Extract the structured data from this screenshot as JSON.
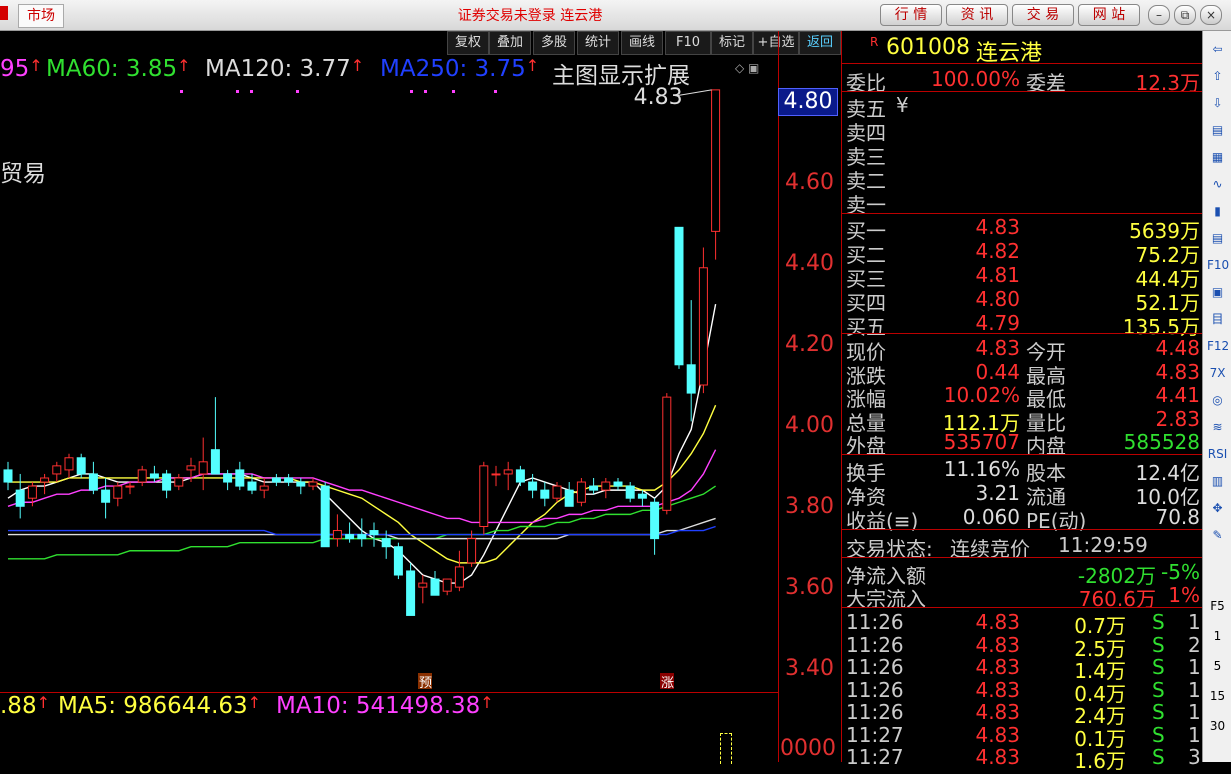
{
  "titlebar": {
    "market_label": "市场",
    "title": "证券交易未登录 连云港",
    "buttons": [
      "行 情",
      "资 讯",
      "交 易",
      "网 站"
    ],
    "win_controls": [
      "–",
      "⧉",
      "×"
    ]
  },
  "toolbar": {
    "items": [
      "复权",
      "叠加",
      "多股",
      "统计",
      "画线",
      "F10",
      "标记",
      "+自选",
      "返回"
    ],
    "active": "返回"
  },
  "ma_row": [
    {
      "label": "95",
      "arrow": "↑",
      "color": "#ff40ff"
    },
    {
      "label": "MA60: 3.85",
      "arrow": "↑",
      "color": "#30e030"
    },
    {
      "label": "MA120: 3.77",
      "arrow": "↑",
      "color": "#dddddd"
    },
    {
      "label": "MA250: 3.75",
      "arrow": "↑",
      "color": "#2040ff"
    }
  ],
  "chart_title_ext": "主图显示扩展",
  "sector_text": "贸易",
  "peak_label": "4.83",
  "markers": {
    "yu": "预",
    "zhang": "涨"
  },
  "price_tag": "4.80",
  "vol_row": [
    {
      "label": ".88",
      "arrow": "↑",
      "color": "#ffff40"
    },
    {
      "label": "MA5: 986644.63",
      "arrow": "↑",
      "color": "#ffff40"
    },
    {
      "label": "MA10: 541498.38",
      "arrow": "↑",
      "color": "#ff40ff"
    }
  ],
  "vol_axis_label": "0000",
  "chart_data": {
    "type": "candlestick",
    "y_ticks": [
      "4.60",
      "4.40",
      "4.20",
      "4.00",
      "3.80",
      "3.60",
      "3.40"
    ],
    "ylim": [
      3.37,
      4.88
    ],
    "candles": [
      {
        "o": 3.89,
        "h": 3.91,
        "l": 3.84,
        "c": 3.86
      },
      {
        "o": 3.84,
        "h": 3.88,
        "l": 3.77,
        "c": 3.8
      },
      {
        "o": 3.82,
        "h": 3.86,
        "l": 3.8,
        "c": 3.85
      },
      {
        "o": 3.86,
        "h": 3.88,
        "l": 3.83,
        "c": 3.87
      },
      {
        "o": 3.88,
        "h": 3.91,
        "l": 3.86,
        "c": 3.9
      },
      {
        "o": 3.89,
        "h": 3.93,
        "l": 3.87,
        "c": 3.92
      },
      {
        "o": 3.92,
        "h": 3.93,
        "l": 3.87,
        "c": 3.88
      },
      {
        "o": 3.88,
        "h": 3.91,
        "l": 3.83,
        "c": 3.84
      },
      {
        "o": 3.84,
        "h": 3.87,
        "l": 3.77,
        "c": 3.81
      },
      {
        "o": 3.82,
        "h": 3.86,
        "l": 3.8,
        "c": 3.85
      },
      {
        "o": 3.85,
        "h": 3.86,
        "l": 3.83,
        "c": 3.85
      },
      {
        "o": 3.86,
        "h": 3.9,
        "l": 3.85,
        "c": 3.89
      },
      {
        "o": 3.88,
        "h": 3.9,
        "l": 3.86,
        "c": 3.87
      },
      {
        "o": 3.88,
        "h": 3.89,
        "l": 3.82,
        "c": 3.84
      },
      {
        "o": 3.85,
        "h": 3.88,
        "l": 3.84,
        "c": 3.87
      },
      {
        "o": 3.89,
        "h": 3.92,
        "l": 3.86,
        "c": 3.9
      },
      {
        "o": 3.88,
        "h": 3.97,
        "l": 3.84,
        "c": 3.91
      },
      {
        "o": 3.94,
        "h": 4.07,
        "l": 3.9,
        "c": 3.88
      },
      {
        "o": 3.88,
        "h": 3.89,
        "l": 3.84,
        "c": 3.86
      },
      {
        "o": 3.89,
        "h": 3.91,
        "l": 3.84,
        "c": 3.85
      },
      {
        "o": 3.86,
        "h": 3.88,
        "l": 3.83,
        "c": 3.84
      },
      {
        "o": 3.84,
        "h": 3.87,
        "l": 3.82,
        "c": 3.85
      },
      {
        "o": 3.87,
        "h": 3.88,
        "l": 3.85,
        "c": 3.86
      },
      {
        "o": 3.87,
        "h": 3.88,
        "l": 3.85,
        "c": 3.86
      },
      {
        "o": 3.86,
        "h": 3.87,
        "l": 3.83,
        "c": 3.85
      },
      {
        "o": 3.85,
        "h": 3.87,
        "l": 3.84,
        "c": 3.86
      },
      {
        "o": 3.85,
        "h": 3.86,
        "l": 3.72,
        "c": 3.7
      },
      {
        "o": 3.72,
        "h": 3.78,
        "l": 3.7,
        "c": 3.74
      },
      {
        "o": 3.73,
        "h": 3.76,
        "l": 3.71,
        "c": 3.72
      },
      {
        "o": 3.73,
        "h": 3.77,
        "l": 3.7,
        "c": 3.72
      },
      {
        "o": 3.74,
        "h": 3.76,
        "l": 3.7,
        "c": 3.73
      },
      {
        "o": 3.72,
        "h": 3.74,
        "l": 3.67,
        "c": 3.7
      },
      {
        "o": 3.7,
        "h": 3.71,
        "l": 3.62,
        "c": 3.63
      },
      {
        "o": 3.64,
        "h": 3.66,
        "l": 3.55,
        "c": 3.53
      },
      {
        "o": 3.6,
        "h": 3.63,
        "l": 3.56,
        "c": 3.61
      },
      {
        "o": 3.62,
        "h": 3.64,
        "l": 3.58,
        "c": 3.58
      },
      {
        "o": 3.59,
        "h": 3.62,
        "l": 3.58,
        "c": 3.62
      },
      {
        "o": 3.6,
        "h": 3.69,
        "l": 3.59,
        "c": 3.65
      },
      {
        "o": 3.66,
        "h": 3.74,
        "l": 3.65,
        "c": 3.72
      },
      {
        "o": 3.75,
        "h": 3.91,
        "l": 3.73,
        "c": 3.9
      },
      {
        "o": 3.88,
        "h": 3.9,
        "l": 3.85,
        "c": 3.88
      },
      {
        "o": 3.88,
        "h": 3.91,
        "l": 3.84,
        "c": 3.89
      },
      {
        "o": 3.89,
        "h": 3.9,
        "l": 3.85,
        "c": 3.86
      },
      {
        "o": 3.86,
        "h": 3.88,
        "l": 3.82,
        "c": 3.84
      },
      {
        "o": 3.84,
        "h": 3.86,
        "l": 3.8,
        "c": 3.82
      },
      {
        "o": 3.82,
        "h": 3.86,
        "l": 3.81,
        "c": 3.85
      },
      {
        "o": 3.84,
        "h": 3.86,
        "l": 3.8,
        "c": 3.8
      },
      {
        "o": 3.81,
        "h": 3.87,
        "l": 3.8,
        "c": 3.86
      },
      {
        "o": 3.85,
        "h": 3.87,
        "l": 3.83,
        "c": 3.84
      },
      {
        "o": 3.84,
        "h": 3.87,
        "l": 3.82,
        "c": 3.86
      },
      {
        "o": 3.86,
        "h": 3.87,
        "l": 3.84,
        "c": 3.85
      },
      {
        "o": 3.85,
        "h": 3.86,
        "l": 3.81,
        "c": 3.82
      },
      {
        "o": 3.83,
        "h": 3.84,
        "l": 3.8,
        "c": 3.82
      },
      {
        "o": 3.81,
        "h": 3.82,
        "l": 3.68,
        "c": 3.72
      },
      {
        "o": 3.79,
        "h": 4.08,
        "l": 3.78,
        "c": 4.07
      },
      {
        "o": 4.49,
        "h": 4.49,
        "l": 4.14,
        "c": 4.15
      },
      {
        "o": 4.15,
        "h": 4.31,
        "l": 4.01,
        "c": 4.08
      },
      {
        "o": 4.1,
        "h": 4.44,
        "l": 4.08,
        "c": 4.39
      },
      {
        "o": 4.48,
        "h": 4.83,
        "l": 4.41,
        "c": 4.83
      }
    ],
    "ma_lines": [
      {
        "color": "#ffffff",
        "values": [
          3.82,
          3.84,
          3.85,
          3.85,
          3.86,
          3.87,
          3.88,
          3.88,
          3.87,
          3.86,
          3.86,
          3.86,
          3.86,
          3.86,
          3.86,
          3.87,
          3.88,
          3.88,
          3.88,
          3.88,
          3.87,
          3.86,
          3.86,
          3.86,
          3.86,
          3.86,
          3.83,
          3.8,
          3.77,
          3.74,
          3.72,
          3.71,
          3.69,
          3.66,
          3.63,
          3.62,
          3.61,
          3.61,
          3.63,
          3.68,
          3.74,
          3.8,
          3.86,
          3.87,
          3.86,
          3.85,
          3.84,
          3.83,
          3.83,
          3.84,
          3.84,
          3.84,
          3.84,
          3.82,
          3.85,
          3.93,
          3.99,
          4.14,
          4.3
        ]
      },
      {
        "color": "#ffff40",
        "values": [
          3.86,
          3.86,
          3.86,
          3.86,
          3.86,
          3.87,
          3.87,
          3.87,
          3.87,
          3.87,
          3.87,
          3.87,
          3.87,
          3.87,
          3.87,
          3.87,
          3.87,
          3.87,
          3.87,
          3.87,
          3.87,
          3.87,
          3.87,
          3.87,
          3.86,
          3.86,
          3.85,
          3.84,
          3.83,
          3.82,
          3.8,
          3.78,
          3.76,
          3.73,
          3.71,
          3.69,
          3.67,
          3.66,
          3.66,
          3.66,
          3.67,
          3.7,
          3.73,
          3.76,
          3.78,
          3.81,
          3.83,
          3.84,
          3.85,
          3.85,
          3.85,
          3.85,
          3.84,
          3.84,
          3.86,
          3.89,
          3.93,
          3.98,
          4.05
        ]
      },
      {
        "color": "#ff40ff",
        "values": [
          3.8,
          3.81,
          3.81,
          3.82,
          3.83,
          3.83,
          3.84,
          3.84,
          3.85,
          3.85,
          3.86,
          3.86,
          3.86,
          3.87,
          3.87,
          3.87,
          3.88,
          3.88,
          3.88,
          3.88,
          3.88,
          3.87,
          3.87,
          3.87,
          3.87,
          3.87,
          3.86,
          3.85,
          3.84,
          3.84,
          3.83,
          3.82,
          3.81,
          3.8,
          3.79,
          3.78,
          3.77,
          3.77,
          3.76,
          3.76,
          3.76,
          3.76,
          3.76,
          3.76,
          3.77,
          3.77,
          3.78,
          3.78,
          3.79,
          3.79,
          3.8,
          3.8,
          3.8,
          3.8,
          3.81,
          3.82,
          3.84,
          3.88,
          3.94
        ]
      },
      {
        "color": "#30e030",
        "values": [
          3.67,
          3.67,
          3.67,
          3.67,
          3.68,
          3.68,
          3.68,
          3.68,
          3.68,
          3.68,
          3.69,
          3.69,
          3.69,
          3.69,
          3.69,
          3.7,
          3.7,
          3.7,
          3.7,
          3.71,
          3.71,
          3.71,
          3.71,
          3.71,
          3.71,
          3.71,
          3.72,
          3.72,
          3.72,
          3.72,
          3.72,
          3.72,
          3.72,
          3.72,
          3.72,
          3.72,
          3.73,
          3.73,
          3.73,
          3.73,
          3.74,
          3.74,
          3.75,
          3.75,
          3.75,
          3.76,
          3.76,
          3.77,
          3.77,
          3.78,
          3.78,
          3.78,
          3.79,
          3.79,
          3.8,
          3.81,
          3.82,
          3.83,
          3.85
        ]
      },
      {
        "color": "#dddddd",
        "values": [
          3.73,
          3.73,
          3.73,
          3.73,
          3.73,
          3.73,
          3.73,
          3.73,
          3.73,
          3.73,
          3.73,
          3.73,
          3.73,
          3.73,
          3.73,
          3.73,
          3.73,
          3.73,
          3.73,
          3.73,
          3.73,
          3.73,
          3.73,
          3.73,
          3.73,
          3.73,
          3.73,
          3.73,
          3.73,
          3.73,
          3.73,
          3.73,
          3.72,
          3.72,
          3.72,
          3.72,
          3.72,
          3.72,
          3.72,
          3.72,
          3.72,
          3.72,
          3.72,
          3.72,
          3.72,
          3.72,
          3.73,
          3.73,
          3.73,
          3.73,
          3.73,
          3.73,
          3.73,
          3.73,
          3.74,
          3.74,
          3.75,
          3.76,
          3.77
        ]
      },
      {
        "color": "#2040ff",
        "values": [
          3.74,
          3.74,
          3.74,
          3.74,
          3.74,
          3.74,
          3.74,
          3.74,
          3.74,
          3.74,
          3.74,
          3.74,
          3.74,
          3.74,
          3.74,
          3.74,
          3.74,
          3.74,
          3.74,
          3.74,
          3.74,
          3.74,
          3.73,
          3.73,
          3.73,
          3.73,
          3.73,
          3.73,
          3.73,
          3.73,
          3.73,
          3.73,
          3.73,
          3.73,
          3.73,
          3.73,
          3.73,
          3.73,
          3.73,
          3.73,
          3.73,
          3.73,
          3.73,
          3.73,
          3.73,
          3.73,
          3.73,
          3.73,
          3.73,
          3.73,
          3.73,
          3.73,
          3.73,
          3.73,
          3.73,
          3.74,
          3.74,
          3.74,
          3.75
        ]
      }
    ]
  },
  "panel": {
    "stock_badge": "R",
    "stock_code": "601008",
    "stock_name": "连云港",
    "weibi_label": "委比",
    "weibi_value": "100.00%",
    "weicha_label": "委差",
    "weicha_value": "12.3万",
    "sell": [
      {
        "label": "卖五",
        "price": "¥",
        "vol": ""
      },
      {
        "label": "卖四",
        "price": "",
        "vol": ""
      },
      {
        "label": "卖三",
        "price": "",
        "vol": ""
      },
      {
        "label": "卖二",
        "price": "",
        "vol": ""
      },
      {
        "label": "卖一",
        "price": "",
        "vol": ""
      }
    ],
    "buy": [
      {
        "label": "买一",
        "price": "4.83",
        "vol": "5639万"
      },
      {
        "label": "买二",
        "price": "4.82",
        "vol": "75.2万"
      },
      {
        "label": "买三",
        "price": "4.81",
        "vol": "44.4万"
      },
      {
        "label": "买四",
        "price": "4.80",
        "vol": "52.1万"
      },
      {
        "label": "买五",
        "price": "4.79",
        "vol": "135.5万"
      }
    ],
    "quote": [
      {
        "l1": "现价",
        "v1": "4.83",
        "c1": "#ff3030",
        "l2": "今开",
        "v2": "4.48",
        "c2": "#ff3030"
      },
      {
        "l1": "涨跌",
        "v1": "0.44",
        "c1": "#ff3030",
        "l2": "最高",
        "v2": "4.83",
        "c2": "#ff3030"
      },
      {
        "l1": "涨幅",
        "v1": "10.02%",
        "c1": "#ff3030",
        "l2": "最低",
        "v2": "4.41",
        "c2": "#ff3030"
      },
      {
        "l1": "总量",
        "v1": "112.1万",
        "c1": "#ffff40",
        "l2": "量比",
        "v2": "2.83",
        "c2": "#ff3030"
      },
      {
        "l1": "外盘",
        "v1": "535707",
        "c1": "#ff3030",
        "l2": "内盘",
        "v2": "585528",
        "c2": "#30e030"
      }
    ],
    "fund": [
      {
        "l1": "换手",
        "v1": "11.16%",
        "l2": "股本",
        "v2": "12.4亿"
      },
      {
        "l1": "净资",
        "v1": "3.21",
        "l2": "流通",
        "v2": "10.0亿"
      },
      {
        "l1": "收益(≡)",
        "v1": "0.060",
        "l2": "PE(动)",
        "v2": "70.8"
      }
    ],
    "status_label": "交易状态:",
    "status_value": "连续竞价",
    "status_time": "11:29:59",
    "flow": [
      {
        "label": "净流入额",
        "value": "-2802万",
        "pct": "-5%",
        "color": "#30e030"
      },
      {
        "label": "大宗流入",
        "value": "760.6万",
        "pct": "1%",
        "color": "#ff3030"
      }
    ],
    "ticks": [
      {
        "time": "11:26",
        "price": "4.83",
        "vol": "0.7万",
        "side": "S",
        "n": "1"
      },
      {
        "time": "11:26",
        "price": "4.83",
        "vol": "2.5万",
        "side": "S",
        "n": "2"
      },
      {
        "time": "11:26",
        "price": "4.83",
        "vol": "1.4万",
        "side": "S",
        "n": "1"
      },
      {
        "time": "11:26",
        "price": "4.83",
        "vol": "0.4万",
        "side": "S",
        "n": "1"
      },
      {
        "time": "11:26",
        "price": "4.83",
        "vol": "2.4万",
        "side": "S",
        "n": "1"
      },
      {
        "time": "11:27",
        "price": "4.83",
        "vol": "0.1万",
        "side": "S",
        "n": "1"
      },
      {
        "time": "11:27",
        "price": "4.83",
        "vol": "1.6万",
        "side": "S",
        "n": "3"
      }
    ]
  },
  "sidebar": {
    "icons": [
      "up-arrow-left-icon",
      "up-arrow-icon",
      "down-arrow-icon",
      "book-icon",
      "grid-icon",
      "line-chart-icon",
      "candle-icon",
      "list-icon",
      "F10",
      "doc-icon",
      "notebook-icon",
      "F12",
      "fx-icon",
      "circle-icon",
      "wave-icon",
      "RSI",
      "bar-icon",
      "move-icon",
      "pencil-icon"
    ],
    "labels": [
      "⇦",
      "⇧",
      "⇩",
      "▤",
      "▦",
      "∿",
      "▮",
      "▤",
      "F10",
      "▣",
      "目",
      "F12",
      "7X",
      "◎",
      "≋",
      "RSI",
      "▥",
      "✥",
      "✎"
    ],
    "bottom": [
      "F5",
      "1",
      "5",
      "15",
      "30"
    ]
  }
}
